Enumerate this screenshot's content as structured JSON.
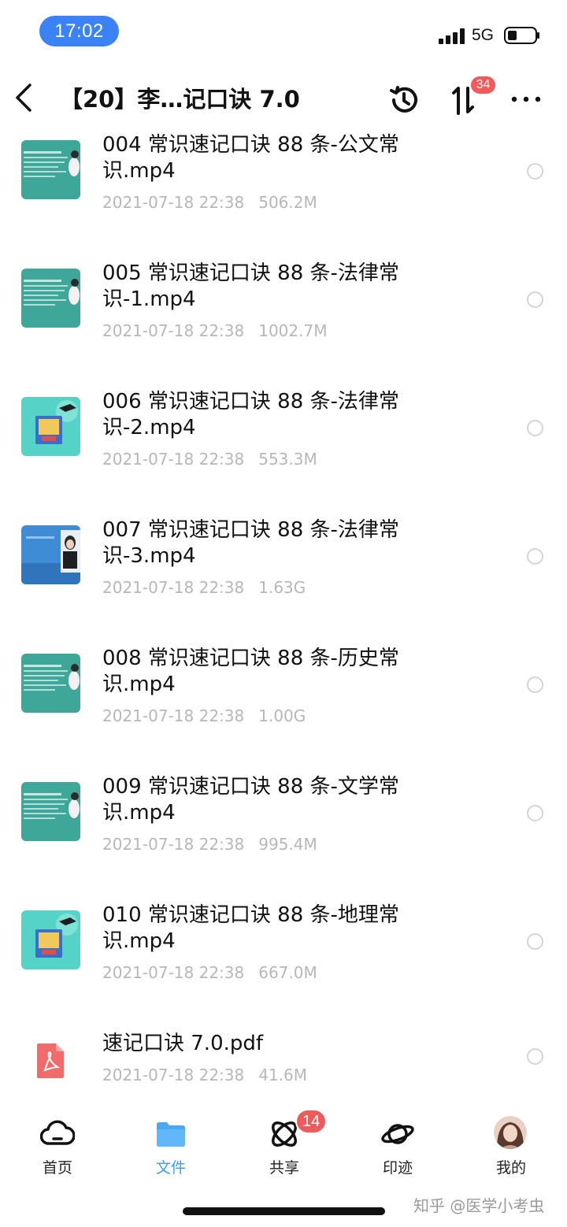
{
  "status_bar": {
    "time": "17:02",
    "network": "5G"
  },
  "nav": {
    "title": "【20】李…记口诀 7.0",
    "transfer_badge": "34"
  },
  "files": [
    {
      "name": "004 常识速记口诀 88 条-公文常识.mp4",
      "date": "2021-07-18 22:38",
      "size": "506.2M",
      "thumb": "lecture-green"
    },
    {
      "name": "005 常识速记口诀 88 条-法律常识-1.mp4",
      "date": "2021-07-18 22:38",
      "size": "1002.7M",
      "thumb": "lecture-green"
    },
    {
      "name": "006 常识速记口诀 88 条-法律常识-2.mp4",
      "date": "2021-07-18 22:38",
      "size": "553.3M",
      "thumb": "book-teal"
    },
    {
      "name": "007 常识速记口诀 88 条-法律常识-3.mp4",
      "date": "2021-07-18 22:38",
      "size": "1.63G",
      "thumb": "presenter-blue"
    },
    {
      "name": "008 常识速记口诀 88 条-历史常识.mp4",
      "date": "2021-07-18 22:38",
      "size": "1.00G",
      "thumb": "lecture-green"
    },
    {
      "name": "009 常识速记口诀 88 条-文学常识.mp4",
      "date": "2021-07-18 22:38",
      "size": "995.4M",
      "thumb": "lecture-green"
    },
    {
      "name": "010 常识速记口诀 88 条-地理常识.mp4",
      "date": "2021-07-18 22:38",
      "size": "667.0M",
      "thumb": "book-teal"
    },
    {
      "name": "速记口诀 7.0.pdf",
      "date": "2021-07-18 22:38",
      "size": "41.6M",
      "thumb": "pdf-icon"
    }
  ],
  "tabs": [
    {
      "label": "首页",
      "icon": "cloud-home-icon"
    },
    {
      "label": "文件",
      "icon": "folder-icon",
      "active": true
    },
    {
      "label": "共享",
      "icon": "share-orbit-icon",
      "badge": "14"
    },
    {
      "label": "印迹",
      "icon": "planet-icon"
    },
    {
      "label": "我的",
      "icon": "avatar"
    }
  ],
  "watermark": "知乎 @医学小考虫",
  "colors": {
    "accent": "#3a9df5",
    "badge": "#f05a5a",
    "time_pill": "#3b82f6",
    "meta_text": "#b7b7b7"
  }
}
